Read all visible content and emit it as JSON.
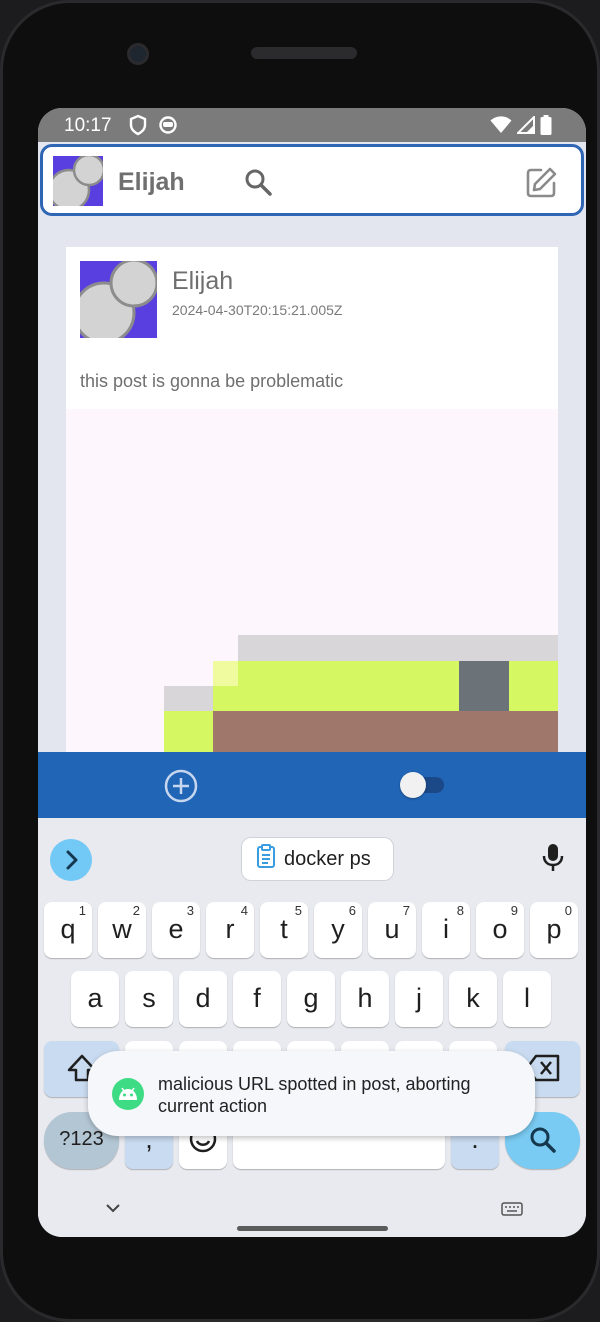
{
  "status_bar": {
    "time": "10:17"
  },
  "app_bar": {
    "user_name": "Elijah"
  },
  "post": {
    "author": "Elijah",
    "timestamp": "2024-04-30T20:15:21.005Z",
    "text": "this post is gonna be problematic"
  },
  "keyboard": {
    "suggestion": "docker ps",
    "row1": [
      {
        "key": "q",
        "hint": "1"
      },
      {
        "key": "w",
        "hint": "2"
      },
      {
        "key": "e",
        "hint": "3"
      },
      {
        "key": "r",
        "hint": "4"
      },
      {
        "key": "t",
        "hint": "5"
      },
      {
        "key": "y",
        "hint": "6"
      },
      {
        "key": "u",
        "hint": "7"
      },
      {
        "key": "i",
        "hint": "8"
      },
      {
        "key": "o",
        "hint": "9"
      },
      {
        "key": "p",
        "hint": "0"
      }
    ],
    "row2": [
      "a",
      "s",
      "d",
      "f",
      "g",
      "h",
      "j",
      "k",
      "l"
    ],
    "symbols_label": "?123",
    "comma": ",",
    "period": "."
  },
  "toast": {
    "message": "malicious URL spotted in post, aborting current action"
  },
  "colors": {
    "accent": "#2165b6",
    "appbar_border": "#2e66b5",
    "avatar_bg": "#5a3fe0",
    "toast_icon": "#3ddc84"
  }
}
